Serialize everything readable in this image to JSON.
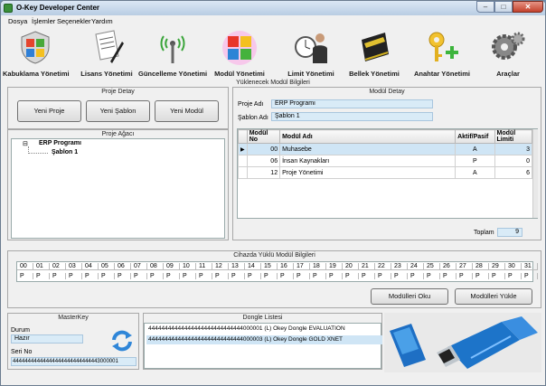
{
  "window": {
    "title": "O-Key Developer Center"
  },
  "menu": [
    "Dosya",
    "İşlemler",
    "Seçenekler",
    "Yardım"
  ],
  "toolbar": [
    {
      "label": "Kabuklama Yönetimi",
      "icon": "shield-windows-icon"
    },
    {
      "label": "Lisans Yönetimi",
      "icon": "document-pen-icon"
    },
    {
      "label": "Güncelleme Yönetimi",
      "icon": "antenna-icon"
    },
    {
      "label": "Modül Yönetimi",
      "icon": "cubes-icon"
    },
    {
      "label": "Limit Yönetimi",
      "icon": "clock-man-icon"
    },
    {
      "label": "Bellek Yönetimi",
      "icon": "memory-chip-icon"
    },
    {
      "label": "Anahtar Yönetimi",
      "icon": "key-plus-icon"
    },
    {
      "label": "Araçlar",
      "icon": "gears-icon"
    }
  ],
  "section_title": "Yüklenecek Modül Bilgileri",
  "proje_detay": {
    "title": "Proje Detay",
    "buttons": [
      "Yeni Proje",
      "Yeni Şablon",
      "Yeni Modül"
    ]
  },
  "proje_agaci": {
    "title": "Proje Ağacı",
    "root": "ERP Programı",
    "child": "Şablon 1"
  },
  "modul_detay": {
    "title": "Modül Detay",
    "proje_adi_label": "Proje Adı",
    "proje_adi": "ERP Programı",
    "sablon_adi_label": "Şablon Adı",
    "sablon_adi": "Şablon 1",
    "columns": [
      "Modül No",
      "Modül Adı",
      "Aktif/Pasif",
      "Modül Limiti"
    ],
    "rows": [
      [
        "00",
        "Muhasebe",
        "A",
        "3"
      ],
      [
        "06",
        "İnsan Kaynakları",
        "P",
        "0"
      ],
      [
        "12",
        "Proje Yönetimi",
        "A",
        "6"
      ]
    ],
    "toplam_label": "Toplam",
    "toplam": "9"
  },
  "cihazda": {
    "title": "Cihazda Yüklü Modül Bilgileri",
    "ports": [
      "00",
      "01",
      "02",
      "03",
      "04",
      "05",
      "06",
      "07",
      "08",
      "09",
      "10",
      "11",
      "12",
      "13",
      "14",
      "15",
      "16",
      "17",
      "18",
      "19",
      "20",
      "21",
      "22",
      "23",
      "24",
      "25",
      "26",
      "27",
      "28",
      "29",
      "30",
      "31"
    ],
    "values": [
      "P",
      "P",
      "P",
      "P",
      "P",
      "P",
      "P",
      "P",
      "P",
      "P",
      "P",
      "P",
      "P",
      "P",
      "P",
      "P",
      "P",
      "P",
      "P",
      "P",
      "P",
      "P",
      "P",
      "P",
      "P",
      "P",
      "P",
      "P",
      "P",
      "P",
      "P",
      "P"
    ],
    "read_button": "Modülleri Oku",
    "load_button": "Modülleri Yükle"
  },
  "masterkey": {
    "title": "MasterKey",
    "durum_label": "Durum",
    "durum": "Hazır",
    "seri_label": "Seri No",
    "seri": "44444444444444444444444444443000001"
  },
  "dongle": {
    "title": "Dongle Listesi",
    "items": [
      "44444444444444444444444444444000001 (L) Okey Dongle EVALUATION",
      "44444444444444444444444444444000003 (L) Okey Dongle GOLD XNET"
    ]
  },
  "colors": {
    "selection": "#cfe5f5",
    "field": "#d9ebf7"
  }
}
